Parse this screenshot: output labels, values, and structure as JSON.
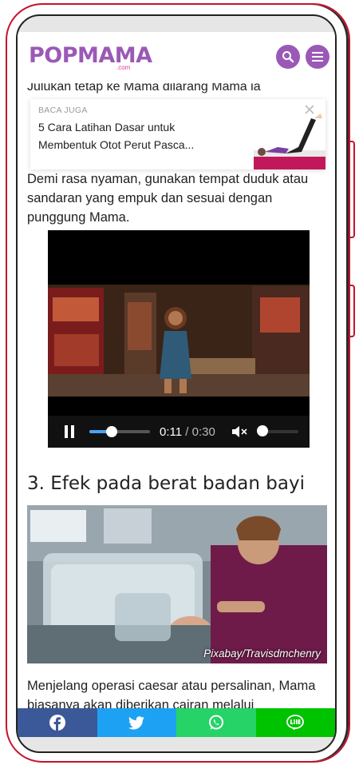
{
  "header": {
    "logo": "POPMAMA",
    "logo_suffix": ".com",
    "search_icon": "search-icon",
    "menu_icon": "hamburger-menu-icon"
  },
  "article": {
    "cut_text": "Julukan tetap ke Mama dilarang Mama ia",
    "baca_juga": {
      "label": "BACA JUGA",
      "title": "5 Cara Latihan Dasar untuk Membentuk Otot Perut Pasca...",
      "close_icon": "close-icon"
    },
    "paragraph_1": "Demi rasa nyaman, gunakan tempat duduk atau sandaran yang empuk dan sesuai dengan punggung Mama.",
    "video": {
      "current_time": "0:11",
      "separator": " / ",
      "duration": "0:30",
      "progress": 0.367,
      "volume": 0,
      "pause_icon": "pause-icon",
      "mute_icon": "volume-muted-icon"
    },
    "heading_3": "3. Efek pada berat badan bayi",
    "photo_caption": "Pixabay/Travisdmchenry",
    "paragraph_2": "Menjelang operasi caesar atau persalinan, Mama biasanya akan diberikan cairan melalui"
  },
  "share_bar": [
    {
      "name": "facebook",
      "icon": "facebook-icon",
      "color": "#3b5998"
    },
    {
      "name": "twitter",
      "icon": "twitter-icon",
      "color": "#1da1f2"
    },
    {
      "name": "whatsapp",
      "icon": "whatsapp-icon",
      "color": "#25d366"
    },
    {
      "name": "line",
      "icon": "line-icon",
      "color": "#00c300"
    }
  ],
  "colors": {
    "brand": "#9b59b6",
    "frame": "#c8102e"
  }
}
